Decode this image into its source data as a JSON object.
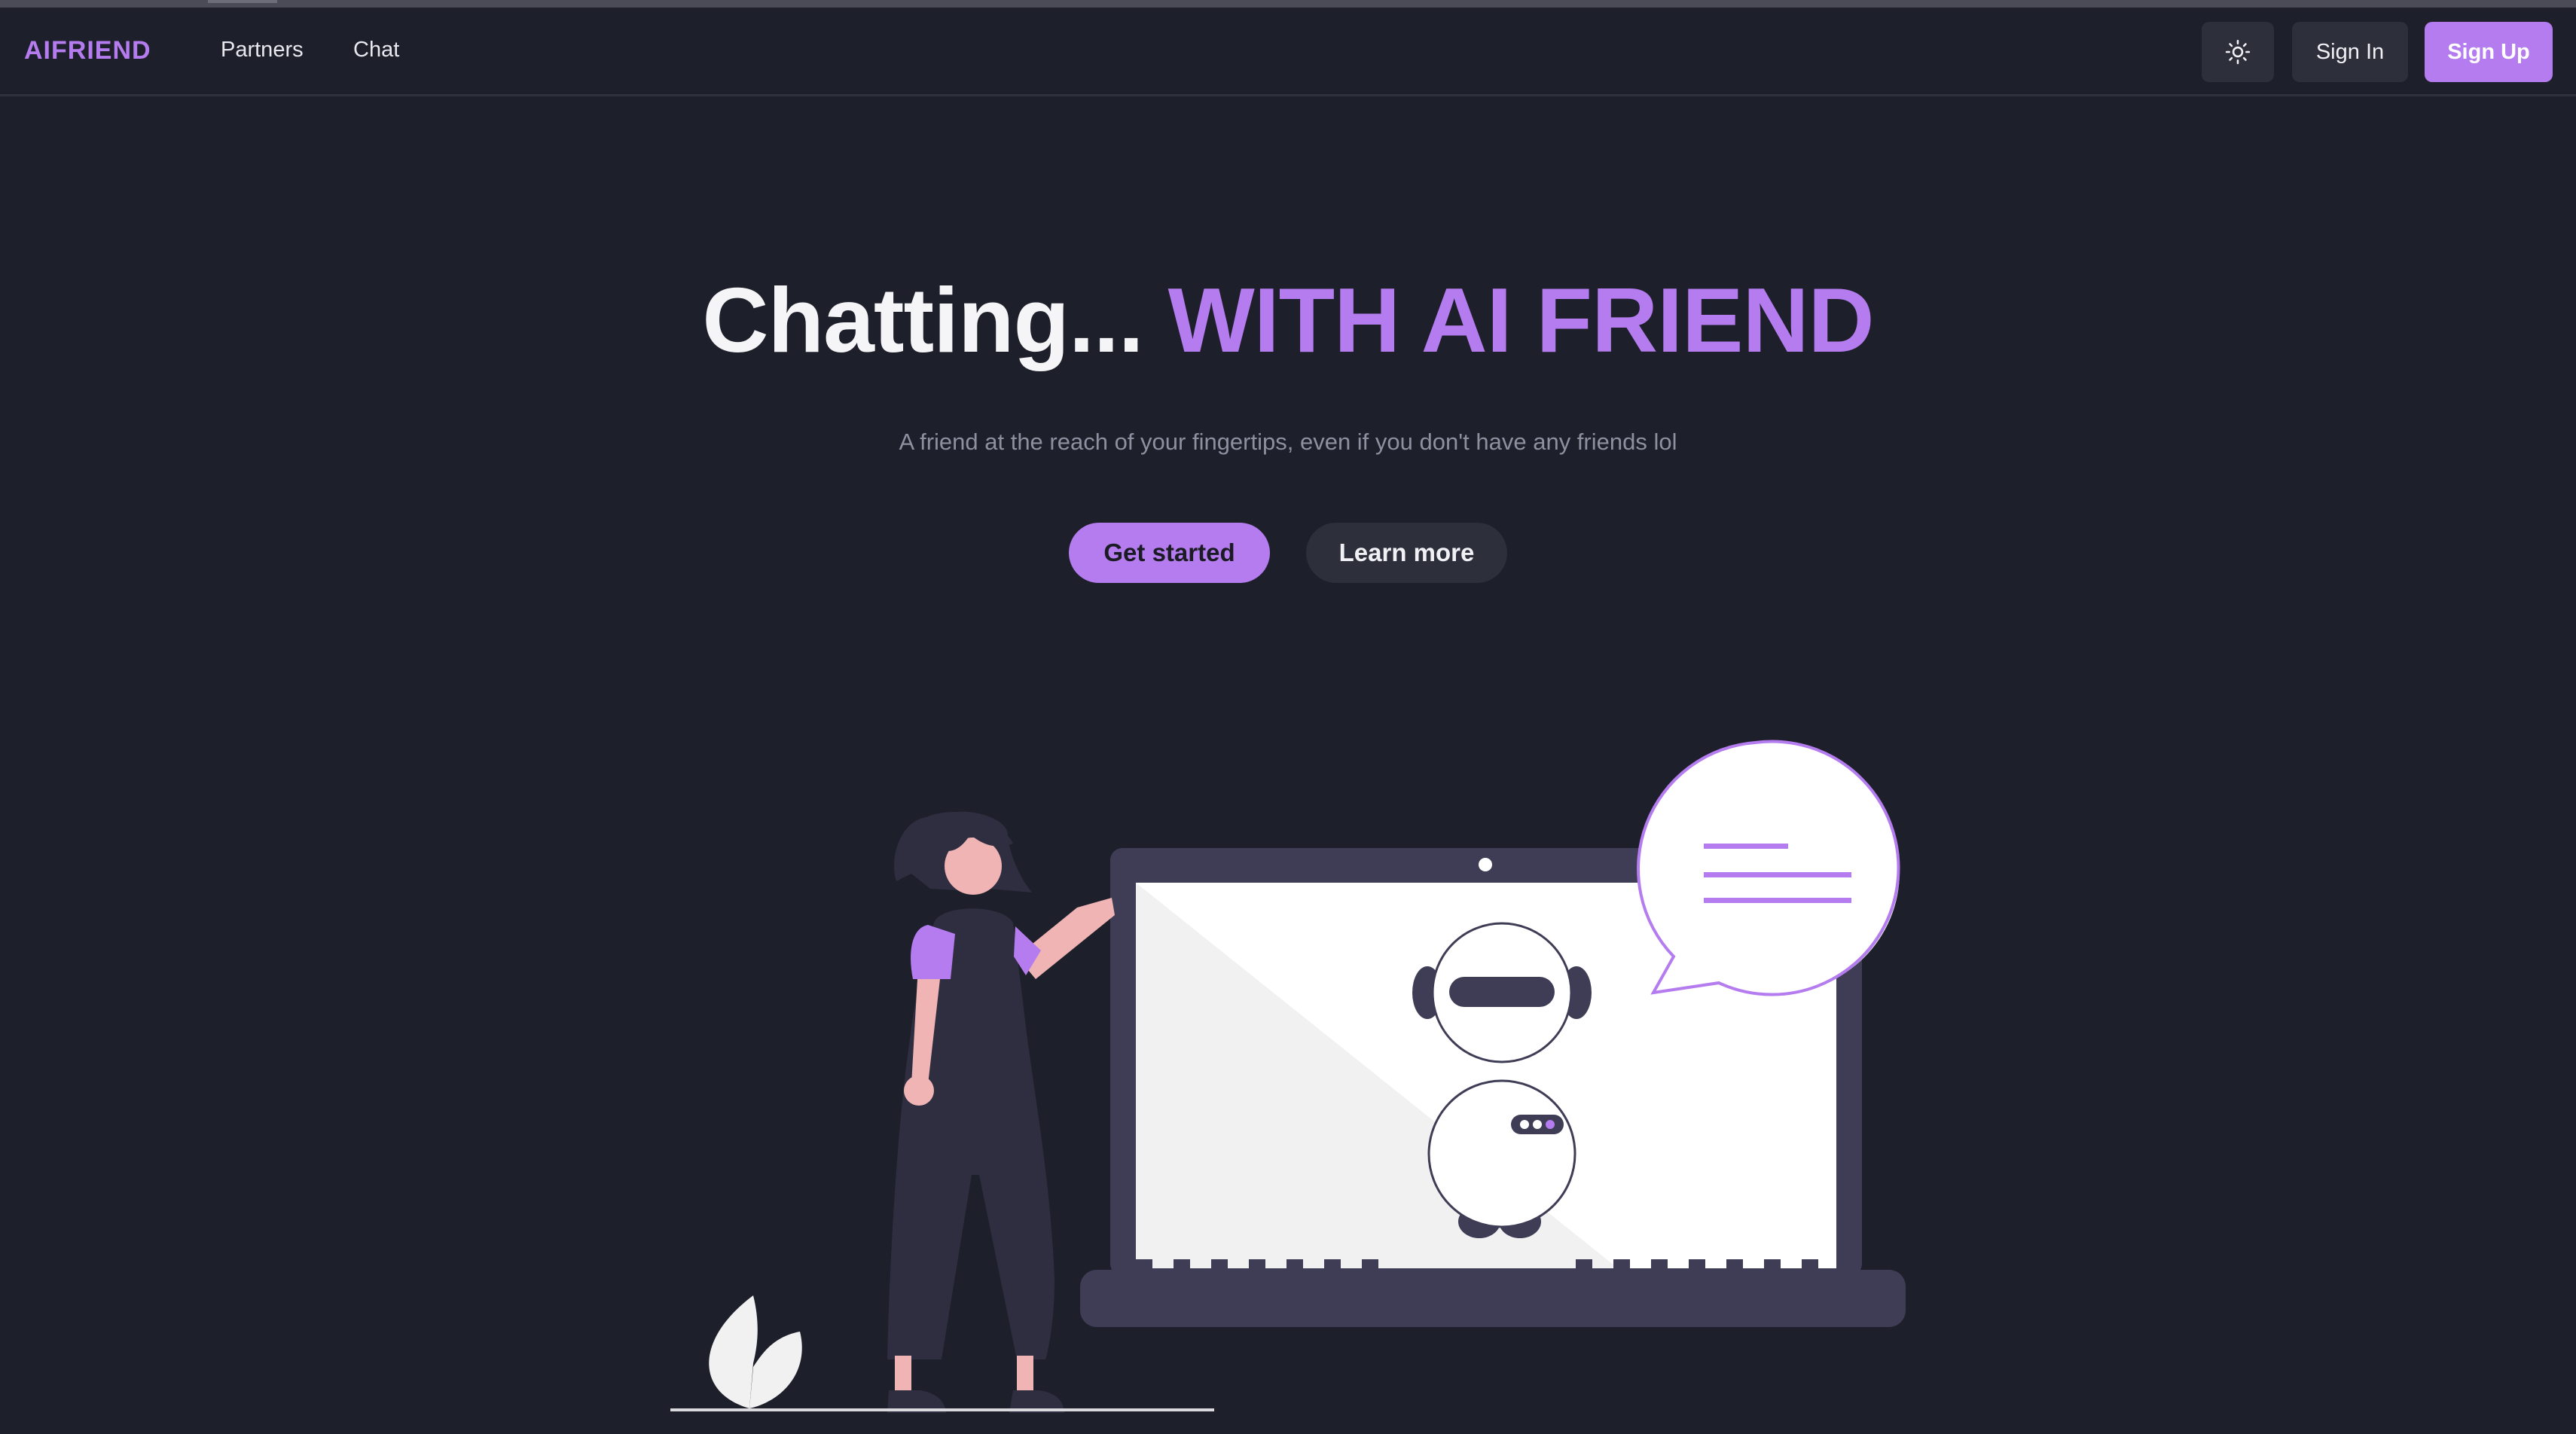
{
  "header": {
    "logo": "AIFRIEND",
    "nav": [
      {
        "label": "Partners"
      },
      {
        "label": "Chat"
      }
    ],
    "theme_icon": "sun-icon",
    "sign_in": "Sign In",
    "sign_up": "Sign Up"
  },
  "hero": {
    "title_part1": "Chatting...",
    "title_part2": "WITH AI FRIEND",
    "subtitle": "A friend at the reach of your fingertips, even if you don't have any friends lol",
    "primary_cta": "Get started",
    "secondary_cta": "Learn more"
  },
  "colors": {
    "background": "#1d1f2a",
    "accent": "#b57cf0",
    "surface": "#2d2f3b",
    "text_muted": "#8e90a0"
  }
}
